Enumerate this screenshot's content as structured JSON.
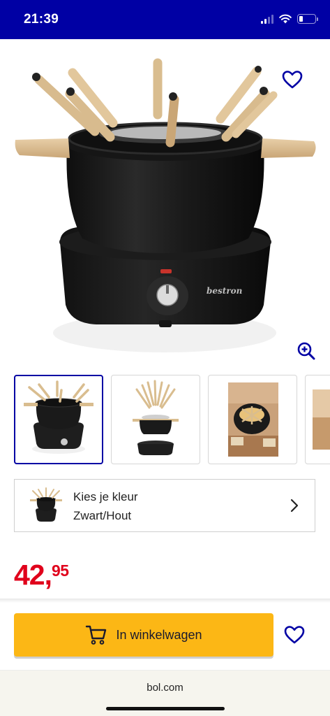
{
  "status_bar": {
    "time": "21:39",
    "battery_level": 0.22
  },
  "product": {
    "brand_logo_text": "bestron",
    "gallery_count_visible": 4,
    "active_thumbnail": 0
  },
  "color_selector": {
    "label": "Kies je kleur",
    "value": "Zwart/Hout"
  },
  "price": {
    "integer": "42,",
    "decimals": "95"
  },
  "cart": {
    "button_label": "In winkelwagen"
  },
  "browser": {
    "url": "bol.com"
  },
  "icons": {
    "favorite": "heart-icon",
    "zoom": "zoom-in-icon",
    "cart": "shopping-cart-icon",
    "chevron": "chevron-right-icon"
  },
  "colors": {
    "brand_blue": "#0000a4",
    "price_red": "#e0001b",
    "cart_yellow": "#fcb715"
  }
}
